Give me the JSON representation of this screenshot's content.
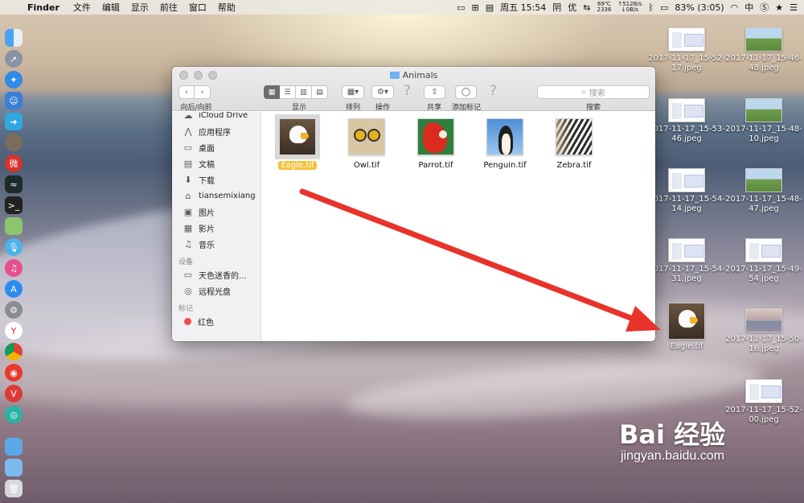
{
  "menubar": {
    "app_name": "Finder",
    "items": [
      "文件",
      "编辑",
      "显示",
      "前往",
      "窗口",
      "帮助"
    ],
    "clock": "周五 15:54",
    "weather_label": "阴",
    "input_label": "优",
    "temp_line1": "69℃",
    "temp_line2": "2336",
    "net_up": "↑512B/s",
    "net_down": "↓0B/s",
    "battery": "83% (3:05)",
    "ime": "中"
  },
  "finder": {
    "title": "Animals",
    "toolbar": {
      "nav_label": "向后/向前",
      "view_label": "显示",
      "arrange_label": "排列",
      "action_label": "操作",
      "share_label": "共享",
      "tags_label": "添加标记",
      "search_placeholder": "搜索",
      "search_label": "搜索"
    },
    "sidebar": {
      "favorites": [
        {
          "label": "iCloud Drive",
          "icon": "cloud-icon"
        },
        {
          "label": "应用程序",
          "icon": "applications-icon"
        },
        {
          "label": "桌面",
          "icon": "desktop-icon"
        },
        {
          "label": "文稿",
          "icon": "documents-icon"
        },
        {
          "label": "下载",
          "icon": "downloads-icon"
        },
        {
          "label": "tiansemixiang",
          "icon": "home-icon"
        },
        {
          "label": "图片",
          "icon": "pictures-icon"
        },
        {
          "label": "影片",
          "icon": "movies-icon"
        },
        {
          "label": "音乐",
          "icon": "music-icon"
        }
      ],
      "devices_header": "设备",
      "devices": [
        {
          "label": "天色迷香的...",
          "icon": "laptop-icon"
        },
        {
          "label": "远程光盘",
          "icon": "disc-icon"
        }
      ],
      "tags_header": "标记",
      "tags": [
        {
          "label": "红色",
          "color": "#ef4c49"
        }
      ]
    },
    "files": [
      {
        "label": "Eagle.tif",
        "selected": true
      },
      {
        "label": "Owl.tif",
        "selected": false
      },
      {
        "label": "Parrot.tif",
        "selected": false
      },
      {
        "label": "Penguin.tif",
        "selected": false
      },
      {
        "label": "Zebra.tif",
        "selected": false
      }
    ]
  },
  "desktop": {
    "items": [
      {
        "label": "2017-11-17_15-52-\n17.jpeg"
      },
      {
        "label": "2017-11-17_15-46-\n48.jpeg"
      },
      {
        "label": "2017-11-17_15-53-\n46.jpeg"
      },
      {
        "label": "2017-11-17_15-48-\n10.jpeg"
      },
      {
        "label": "2017-11-17_15-54-\n14.jpeg"
      },
      {
        "label": "2017-11-17_15-48-\n47.jpeg"
      },
      {
        "label": "2017-11-17_15-54-\n31.jpeg"
      },
      {
        "label": "2017-11-17_15-49-\n54.jpeg"
      },
      {
        "label": "Eagle.tif"
      },
      {
        "label": "2017-11-17_15-50-\n16.jpeg"
      },
      {
        "label": "2017-11-17_15-52-\n00.jpeg"
      }
    ]
  },
  "colors": {
    "arrow": "#e8332a",
    "selection_label": "#f5c13a",
    "tag_red": "#ef4c49"
  },
  "watermark": {
    "logo": "Bai 经验",
    "url": "jingyan.baidu.com"
  }
}
